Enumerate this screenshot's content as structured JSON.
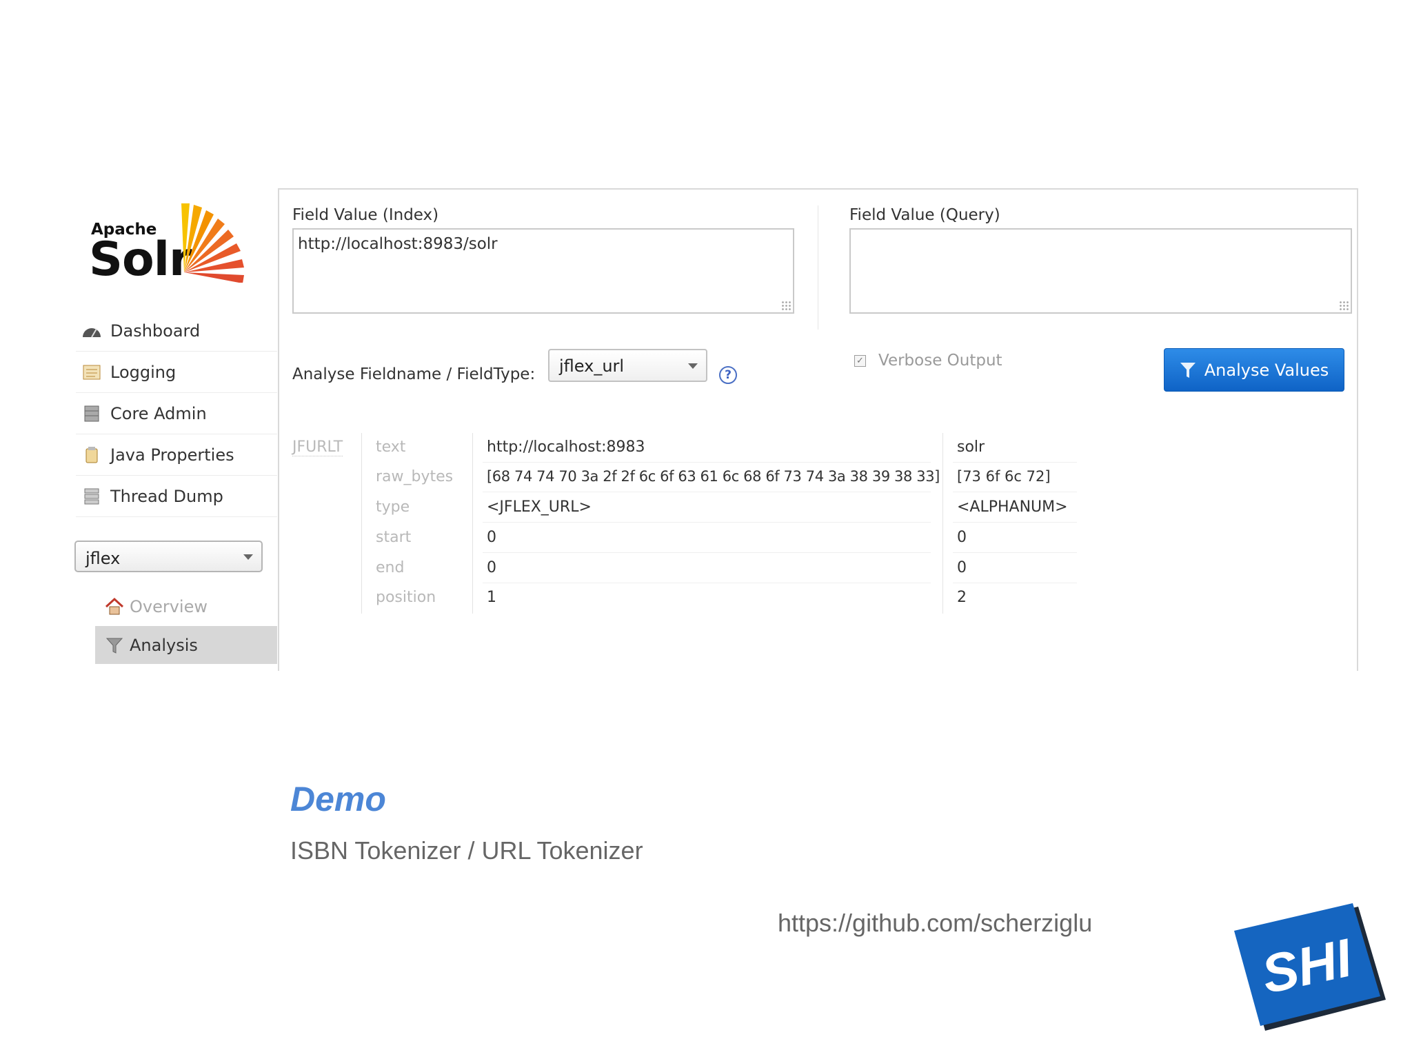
{
  "logo": {
    "apache": "Apache",
    "solr": "Solr",
    "name": "apache-solr-logo"
  },
  "nav": {
    "items": [
      {
        "label": "Dashboard",
        "icon": "dashboard-icon"
      },
      {
        "label": "Logging",
        "icon": "logging-icon"
      },
      {
        "label": "Core Admin",
        "icon": "core-admin-icon"
      },
      {
        "label": "Java Properties",
        "icon": "java-properties-icon"
      },
      {
        "label": "Thread Dump",
        "icon": "thread-dump-icon"
      }
    ],
    "core_select": {
      "value": "jflex"
    },
    "core_items": [
      {
        "label": "Overview",
        "icon": "home-icon"
      },
      {
        "label": "Analysis",
        "icon": "funnel-icon"
      }
    ]
  },
  "analysis": {
    "index_label": "Field Value (Index)",
    "index_value": "http://localhost:8983/solr",
    "query_label": "Field Value (Query)",
    "query_value": "",
    "fieldtype_label": "Analyse Fieldname / FieldType:",
    "fieldtype_value": "jflex_url",
    "help_glyph": "?",
    "verbose_label": "Verbose Output",
    "verbose_checked": true,
    "button_label": "Analyse Values"
  },
  "result": {
    "tokenizer": "JFURLT",
    "attributes": [
      "text",
      "raw_bytes",
      "type",
      "start",
      "end",
      "position"
    ],
    "tokens": [
      {
        "text": "http://localhost:8983",
        "raw_bytes": "[68 74 74 70 3a 2f 2f 6c 6f 63 61 6c 68 6f 73 74 3a 38 39 38 33]",
        "type": "<JFLEX_URL>",
        "start": "0",
        "end": "0",
        "position": "1"
      },
      {
        "text": "solr",
        "raw_bytes": "[73 6f 6c 72]",
        "type": "<ALPHANUM>",
        "start": "0",
        "end": "0",
        "position": "2"
      }
    ]
  },
  "slide": {
    "title": "Demo",
    "subtitle": "ISBN Tokenizer / URL Tokenizer",
    "url": "https://github.com/scherziglu",
    "logo_text": "SHI"
  },
  "colors": {
    "accent": "#4c86d6",
    "button": "#1a73d9",
    "shi_blue": "#1565c0"
  }
}
